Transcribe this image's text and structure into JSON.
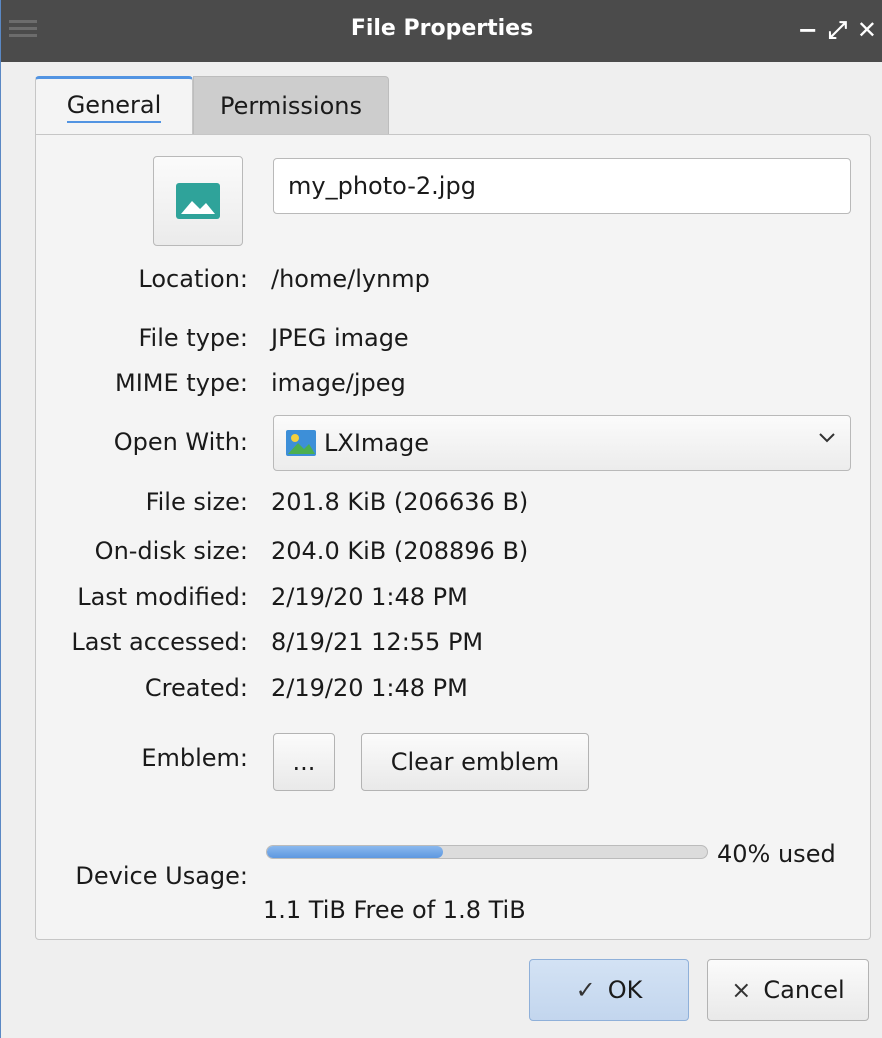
{
  "window": {
    "title": "File Properties",
    "controls": {
      "minimize": "−",
      "maximize": "⤢",
      "close": "✕"
    }
  },
  "tabs": [
    {
      "label": "General",
      "active": true
    },
    {
      "label": "Permissions",
      "active": false
    }
  ],
  "general": {
    "file_icon": "image-file-icon",
    "filename": "my_photo-2.jpg",
    "location": {
      "label": "Location:",
      "value": "/home/lynmp"
    },
    "file_type": {
      "label": "File type:",
      "value": "JPEG image"
    },
    "mime_type": {
      "label": "MIME type:",
      "value": "image/jpeg"
    },
    "open_with": {
      "label": "Open With:",
      "value": "LXImage",
      "icon": "lximage-app-icon"
    },
    "file_size": {
      "label": "File size:",
      "value": "201.8 KiB (206636 B)"
    },
    "ondisk_size": {
      "label": "On-disk size:",
      "value": "204.0 KiB (208896 B)"
    },
    "last_modified": {
      "label": "Last modified:",
      "value": "2/19/20 1:48 PM"
    },
    "last_accessed": {
      "label": "Last accessed:",
      "value": "8/19/21 12:55 PM"
    },
    "created": {
      "label": "Created:",
      "value": "2/19/20 1:48 PM"
    },
    "emblem": {
      "label": "Emblem:",
      "choose_button": "...",
      "clear_button": "Clear emblem"
    },
    "device_usage": {
      "label": "Device Usage:",
      "used_fraction": 0.4,
      "used_text": "40% used",
      "free_text": "1.1 TiB Free of 1.8 TiB"
    }
  },
  "footer": {
    "ok_label": "OK",
    "ok_glyph": "✓",
    "cancel_label": "Cancel",
    "cancel_glyph": "×"
  },
  "colors": {
    "accent": "#5294e2",
    "titlebar": "#4b4b4b",
    "image_icon": "#2fa39a"
  }
}
